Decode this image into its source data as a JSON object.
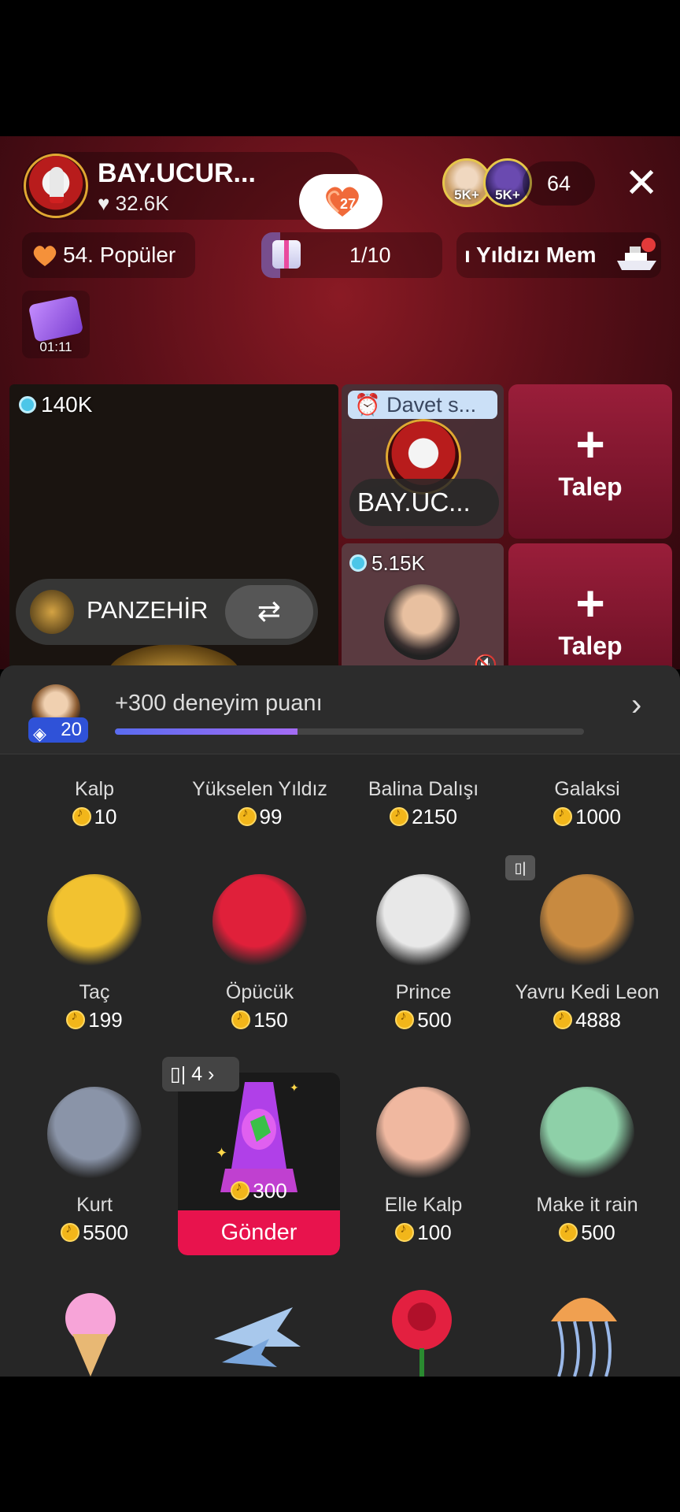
{
  "host": {
    "name": "BAY.UCUR...",
    "likes": "♥ 32.6K",
    "follow_count": "27"
  },
  "viewers": {
    "badge1": "5K+",
    "badge2": "5K+",
    "count": "64"
  },
  "close_glyph": "✕",
  "topbar": {
    "popular": "54. Popüler",
    "gift_goal": "1/10",
    "ticker": "ı Yıldızı   Mem"
  },
  "treasure": {
    "timer": "01:11"
  },
  "guests": {
    "main": {
      "diamonds": "140K",
      "name": "PANZEHİR",
      "swap_glyph": "⇄"
    },
    "invite": {
      "banner": "⏰ Davet s...",
      "name": "BAY.UC..."
    },
    "cam": {
      "diamonds": "5.15K"
    },
    "request_plus": "+",
    "request_label": "Talep"
  },
  "panel": {
    "xp_text": "+300 deneyim puanı",
    "level": "20",
    "xp_progress_pct": 39,
    "chevron": "›",
    "combo": "4",
    "send_label": "Gönder",
    "rows": [
      [
        {
          "name": "Kalp",
          "price": "10",
          "icon": "heart-gift"
        },
        {
          "name": "Yükselen Yıldız",
          "price": "99",
          "icon": "rising-star"
        },
        {
          "name": "Balina Dalışı",
          "price": "2150",
          "icon": "whale-dive"
        },
        {
          "name": "Galaksi",
          "price": "1000",
          "icon": "galaxy"
        }
      ],
      [
        {
          "name": "Taç",
          "price": "199",
          "icon": "crown"
        },
        {
          "name": "Öpücük",
          "price": "150",
          "icon": "kiss-lips"
        },
        {
          "name": "Prince",
          "price": "500",
          "icon": "panda-prince"
        },
        {
          "name": "Yavru Kedi Leon",
          "price": "4888",
          "icon": "lion-cub"
        }
      ],
      [
        {
          "name": "Kurt",
          "price": "5500",
          "icon": "wolf"
        },
        {
          "name": "",
          "price": "300",
          "icon": "lava-lamp"
        },
        {
          "name": "Elle Kalp",
          "price": "100",
          "icon": "hand-heart"
        },
        {
          "name": "Make it rain",
          "price": "500",
          "icon": "money-stack"
        }
      ]
    ]
  },
  "colors": {
    "accent": "#e8134d",
    "level": "#2f52d8",
    "coin": "#f2b61a"
  }
}
